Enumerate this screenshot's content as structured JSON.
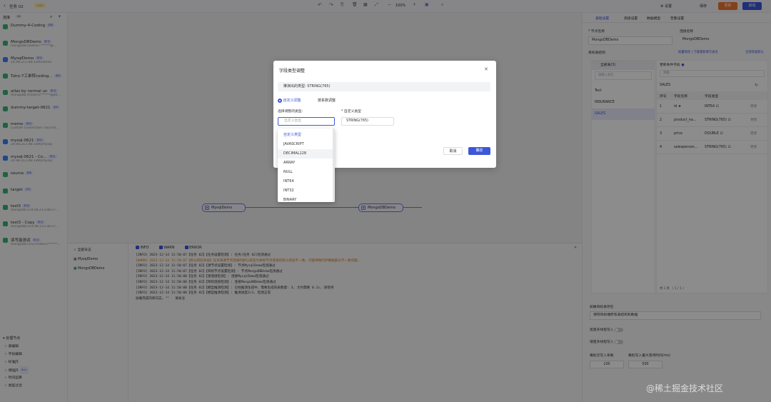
{
  "topbar": {
    "back_title": "任务 02",
    "status_badge": "已运行",
    "zoom": "100%",
    "settings": "设置",
    "save": "保存",
    "btn_orange": "更新",
    "btn_blue": "启动"
  },
  "sidebar": {
    "title": "连接",
    "count": "12",
    "connections": [
      {
        "name": "Dummy-4-Coding",
        "tag": "源库",
        "sub": "",
        "color": "#3bb273"
      },
      {
        "name": "MongoDBDemo",
        "tag": "源/目",
        "sub": "mongodb://admin:******@...",
        "color": "#3bb273"
      },
      {
        "name": "MysqlDemo",
        "tag": "源/目",
        "sub": "24.98.213.48:3306/demo",
        "color": "#3b82f6"
      },
      {
        "name": "Tuho-7工单转coding...",
        "tag": "源库",
        "sub": "",
        "color": "#3bb273"
      },
      {
        "name": "atlas by normal un",
        "tag": "源/目",
        "sub": "mongodb://roderic******@atl...",
        "color": "#3bb273"
      },
      {
        "name": "dummy-target-0621",
        "tag": "目标",
        "sub": "",
        "color": "#3bb273"
      },
      {
        "name": "memo",
        "tag": "源/目",
        "sub": "Custom Connection: source[...",
        "color": "#3bb273"
      },
      {
        "name": "mysql-0621",
        "tag": "源/目",
        "sub": "24.98.213.48:3306/mysql",
        "color": "#3b82f6"
      },
      {
        "name": "mysql-0621 - Co...",
        "tag": "源/目",
        "sub": "24.98.213.48:3306/mysql",
        "color": "#3b82f6"
      },
      {
        "name": "source",
        "tag": "源库",
        "sub": "",
        "color": "#3bb273"
      },
      {
        "name": "target",
        "tag": "目标",
        "sub": "",
        "color": "#3bb273"
      },
      {
        "name": "test3",
        "tag": "源/目",
        "sub": "mongodb://24.98.213.48:27...",
        "color": "#3bb273"
      },
      {
        "name": "test3 - Copy",
        "tag": "源/目",
        "sub": "mongodb://24.98.213.48:27...",
        "color": "#3bb273"
      },
      {
        "name": "读写能测试",
        "tag": "源/目",
        "sub": "mongodb+srv://roderic******...",
        "color": "#3bb273"
      }
    ],
    "section2": "处理节点",
    "processors": [
      "表编辑",
      "字段编辑",
      "标准JS",
      "增强JS",
      "时间运算",
      "类型过滤"
    ],
    "processor_badge": "Beta"
  },
  "canvas": {
    "node_source": "MysqlDemo",
    "node_target": "MongoDBDemo"
  },
  "logs": {
    "tabs": [
      "全部日志",
      "MysqlDemo",
      "MongoDBDemo"
    ],
    "filters": [
      "INFO",
      "WARN",
      "ERROR"
    ],
    "lines": [
      "[INFO] 2023-12-14 11:50:07【任务 02】【任务设置检测】: 任务(任务 02)检测通过",
      "[WARN] 2023-12-14 11:50:07【默认校验失败】任务来源节点连接的默认校验为目标节点连接的默认校验不一致，可能导致同步数据部分不一致问题。",
      "[INFO] 2023-12-14 11:50:07【任务 02】【源节点设置检测】: 节点MysqlDemo检测通过",
      "[INFO] 2023-12-14 11:50:07【任务 02】【目标节点设置检测】: 节点MongoDBDemo检测通过",
      "[INFO] 2023-12-14 11:50:08【任务 02】【源连接检测】: 连接MysqlDemo检测通过",
      "[INFO] 2023-12-14 11:50:08【任务 02】【目标连接检测】: 连接MongoDBDemo检测通过",
      "[INFO] 2023-12-14 11:50:08【任务 02】【模型推演检测】: 已经推演生成中，需要生成的表数量: 3, 大约需要 0.1s, 请等待",
      "[INFO] 2023-12-14 11:50:08【任务 02】【模型推演检测】: 推演进度3/3, 检测正常",
      "加载完成的新日志，\"\"   请关注"
    ]
  },
  "right": {
    "tabs": [
      "基础设置",
      "高级设置",
      "数据模型",
      "告警设置"
    ],
    "node_name_label": "* 节点名称",
    "node_name": "MongoDBDemo",
    "conn_label": "连接名称",
    "conn_value": "MongoDBDemo",
    "target_label": "目标表结构",
    "links": [
      "批量修改 | 下载重新填写表名",
      "全部恢复默认"
    ],
    "left_list_header": "全部表(3)",
    "left_search": "请输入表名",
    "tables": [
      "Test",
      "INSURANCE",
      "SALES"
    ],
    "right_header": "更新条件字段",
    "right_search": "请输",
    "field_table_label": "SALES",
    "cols": [
      "序号",
      "字段名称",
      "字段类型"
    ],
    "rows": [
      {
        "no": "1",
        "name": "id ★",
        "type": "INT64 ☑",
        "act": "更新"
      },
      {
        "no": "2",
        "name": "product_na...",
        "type": "STRING(765) ☑",
        "act": "更新"
      },
      {
        "no": "3",
        "name": "price",
        "type": "DOUBLE ☑",
        "act": "更新"
      },
      {
        "no": "4",
        "name": "salesperson...",
        "type": "STRING(765) ☑",
        "act": "更新"
      }
    ],
    "pager": "共 1 条   〈  1  / 1 〉",
    "exist_label": "如果目标表存在",
    "exist_value": "保持目标端原有表结构和数据",
    "multi_write": "批量多线程写入",
    "sync_write": "增量多线程写入",
    "batch_label": "每批次写入条数",
    "batch_value": "100",
    "wait_label": "每批写入最大等待时间(ms)",
    "wait_value": "500"
  },
  "dialog": {
    "title": "字段类型调整",
    "derived_label": "推演出的类型:",
    "derived_value": "STRING(765)",
    "radio_custom": "自定义调整",
    "radio_rule": "按系数调整",
    "select_label": "选择调整的类型:",
    "custom_label": "* 自定义类型",
    "select_placeholder": "自定义类型",
    "custom_value": "STRING(765)",
    "cancel": "取消",
    "ok": "确定"
  },
  "dropdown": {
    "options": [
      "自定义类型",
      "JAVASCRIPT",
      "DECIMAL128",
      "ARRAY",
      "NULL",
      "INT64",
      "INT32",
      "BINARY"
    ],
    "active": 0,
    "hover": 2
  },
  "watermark": "@稀土掘金技术社区"
}
